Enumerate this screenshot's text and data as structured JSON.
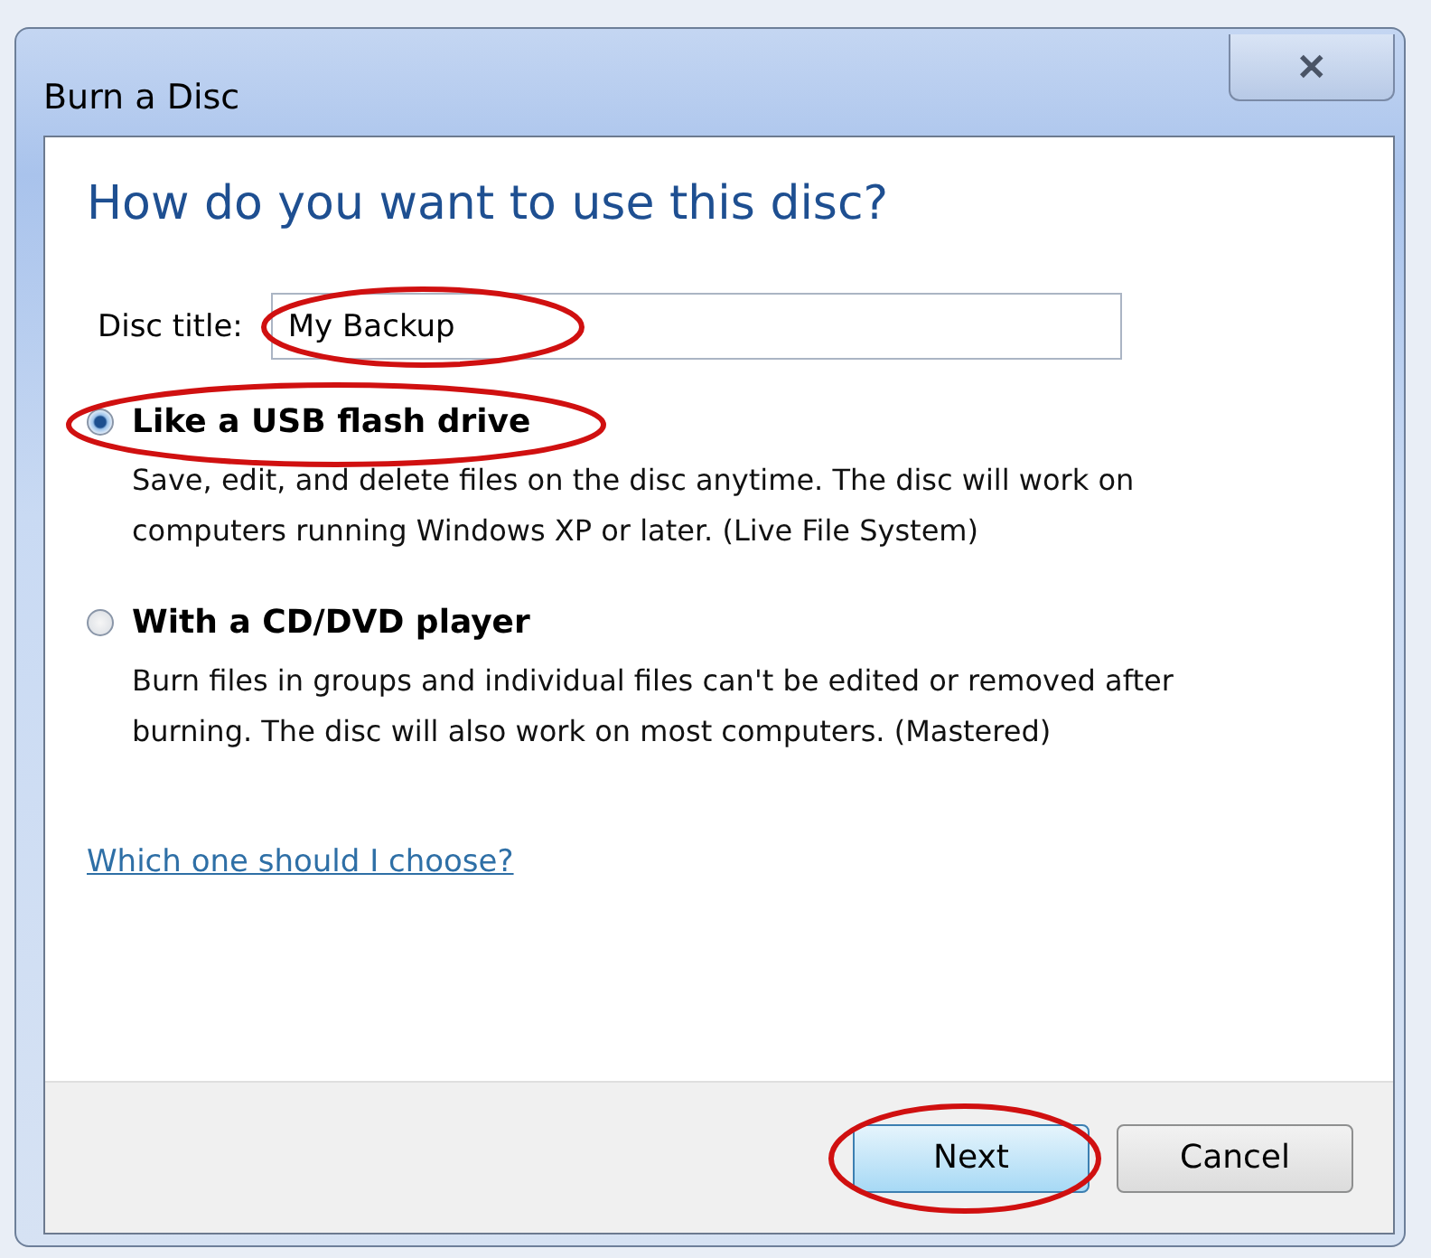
{
  "window": {
    "title": "Burn a Disc",
    "close": "✕"
  },
  "heading": "How do you want to use this disc?",
  "title_field": {
    "label": "Disc title:",
    "value": "My Backup",
    "circled": true
  },
  "options": [
    {
      "label": "Like a USB flash drive",
      "description": "Save, edit, and delete files on the disc anytime. The disc will work on computers running Windows XP or later. (Live File System)",
      "selected": true,
      "circled": true
    },
    {
      "label": "With a CD/DVD player",
      "description": "Burn files in groups and individual files can't be edited or removed after burning. The disc will also work on most computers. (Mastered)",
      "selected": false,
      "circled": false
    }
  ],
  "help_link": "Which one should I choose?",
  "buttons": [
    {
      "label": "Next",
      "kind": "primary",
      "circled": true
    },
    {
      "label": "Cancel",
      "kind": "normal",
      "circled": false
    }
  ]
}
